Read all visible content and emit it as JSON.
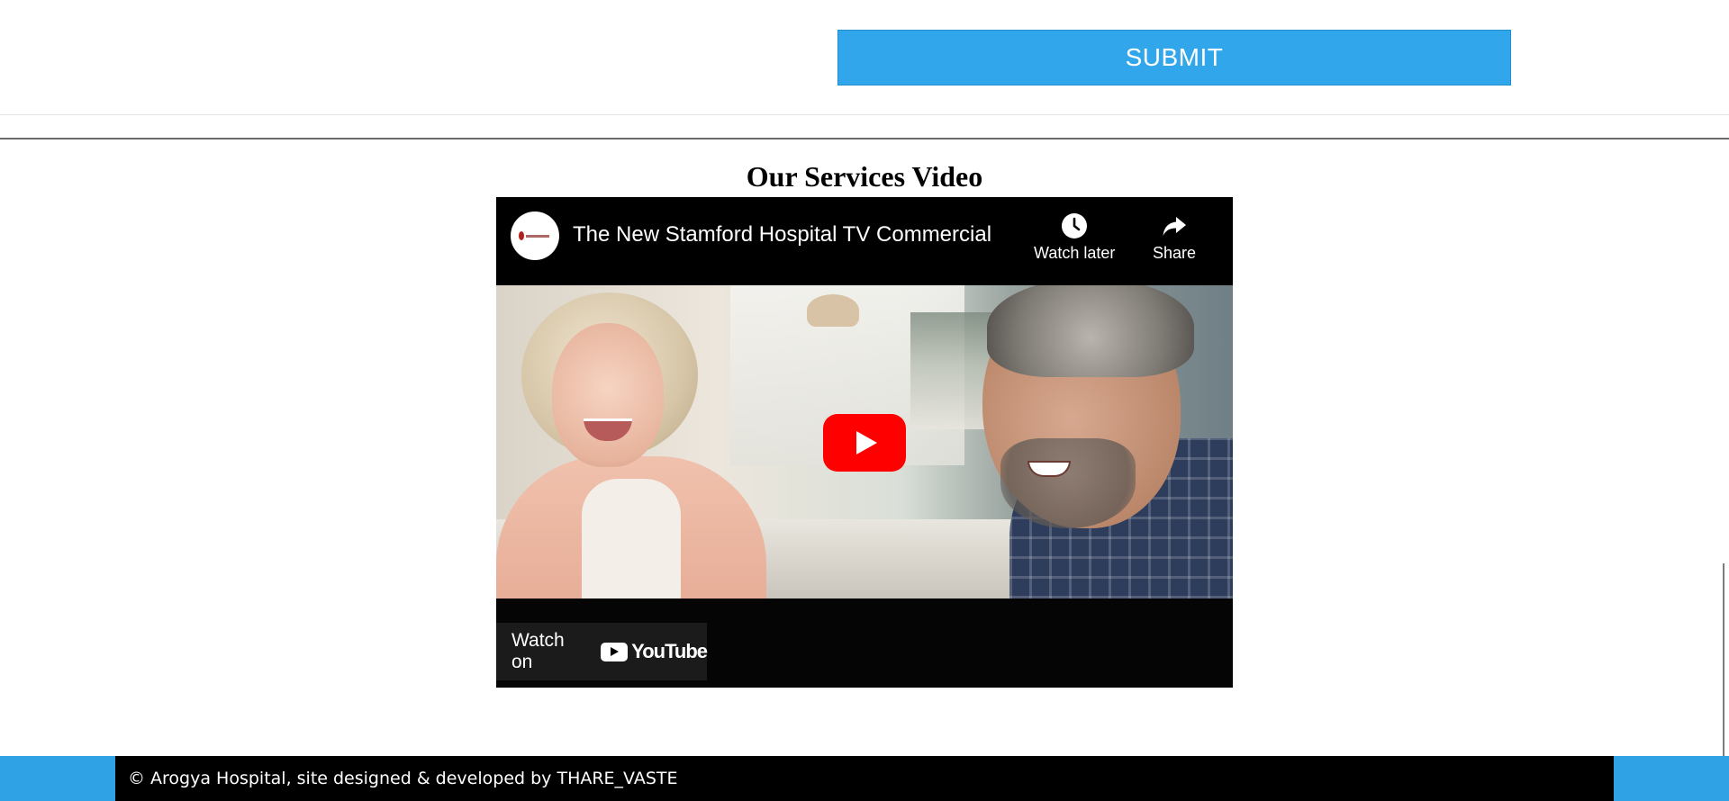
{
  "form": {
    "submit_label": "SUBMIT"
  },
  "section": {
    "title": "Our Services Video"
  },
  "video": {
    "title": "The New Stamford Hospital TV Commercial",
    "channel_avatar": "stamford-health-logo",
    "watch_later_label": "Watch later",
    "share_label": "Share",
    "watch_on_label": "Watch on",
    "youtube_word": "YouTube"
  },
  "footer": {
    "text": "© Arogya Hospital, site designed & developed by THARE_VASTE"
  },
  "colors": {
    "submit_bg": "#31a6ea",
    "footer_accent": "#2fa2e6",
    "youtube_red": "#ff0000"
  }
}
